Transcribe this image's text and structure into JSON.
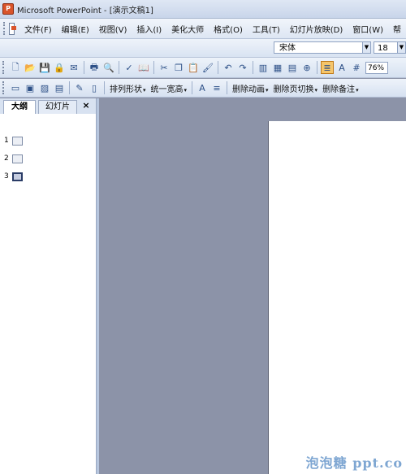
{
  "window": {
    "title": "Microsoft PowerPoint - [演示文稿1]"
  },
  "menu": {
    "items": [
      "文件(F)",
      "编辑(E)",
      "视图(V)",
      "插入(I)",
      "美化大师",
      "格式(O)",
      "工具(T)",
      "幻灯片放映(D)",
      "窗口(W)",
      "帮"
    ]
  },
  "font_toolbar": {
    "font_name": "宋体",
    "font_size": "18"
  },
  "standard_toolbar": {
    "zoom": "76%"
  },
  "format_toolbar": {
    "arrange_shapes": "排列形状",
    "uniform_width": "统一宽高",
    "delete_animation": "删除动画",
    "delete_transition": "删除页切换",
    "delete_notes": "删除备注"
  },
  "left_pane": {
    "tab_outline": "大纲",
    "tab_slides": "幻灯片",
    "close": "×",
    "slides": [
      {
        "number": "1",
        "selected": false
      },
      {
        "number": "2",
        "selected": false
      },
      {
        "number": "3",
        "selected": true
      }
    ]
  },
  "watermark": "泡泡糖 ppt.co"
}
